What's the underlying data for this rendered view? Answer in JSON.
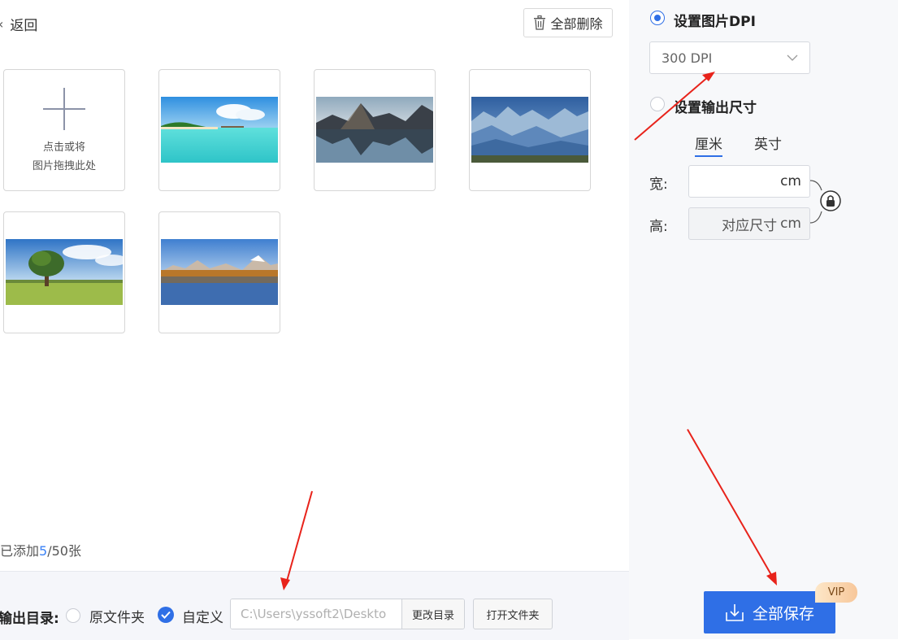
{
  "header": {
    "back_label": "返回",
    "delete_all_label": "全部删除"
  },
  "gallery": {
    "add_card": {
      "line1": "点击或将",
      "line2": "图片拖拽此处"
    },
    "images": [
      {
        "name": "tropical-beach",
        "colors": [
          "#5fb8e8",
          "#3ccfd0"
        ]
      },
      {
        "name": "mountain-lake-reflection",
        "colors": [
          "#9fb8c8",
          "#2e3e4e"
        ]
      },
      {
        "name": "misty-blue-mountains",
        "colors": [
          "#3f78b8",
          "#6a9fcf"
        ]
      },
      {
        "name": "lone-tree-meadow",
        "colors": [
          "#3b7fc9",
          "#8bb84a"
        ]
      },
      {
        "name": "autumn-mountain-lake",
        "colors": [
          "#5a8fd0",
          "#c7842a"
        ]
      }
    ]
  },
  "status": {
    "count_prefix": "已添加",
    "count_current": "5",
    "count_suffix": "/50张"
  },
  "output": {
    "label": "输出目录:",
    "option_original": "原文件夹",
    "option_custom": "自定义",
    "path_placeholder": "C:\\Users\\yssoft2\\Deskto",
    "change_dir_label": "更改目录",
    "open_folder_label": "打开文件夹",
    "selected": "custom"
  },
  "settings": {
    "dpi_title": "设置图片DPI",
    "dpi_value": "300 DPI",
    "size_title": "设置输出尺寸",
    "unit_tabs": [
      "厘米",
      "英寸"
    ],
    "active_unit": 0,
    "width_label": "宽:",
    "height_label": "高:",
    "unit": "cm",
    "height_value": "对应尺寸",
    "selected": "dpi"
  },
  "actions": {
    "save_all_label": "全部保存",
    "vip_badge": "VIP"
  },
  "colors": {
    "accent": "#2f6fe6",
    "annotation_arrow": "#e8231b"
  }
}
